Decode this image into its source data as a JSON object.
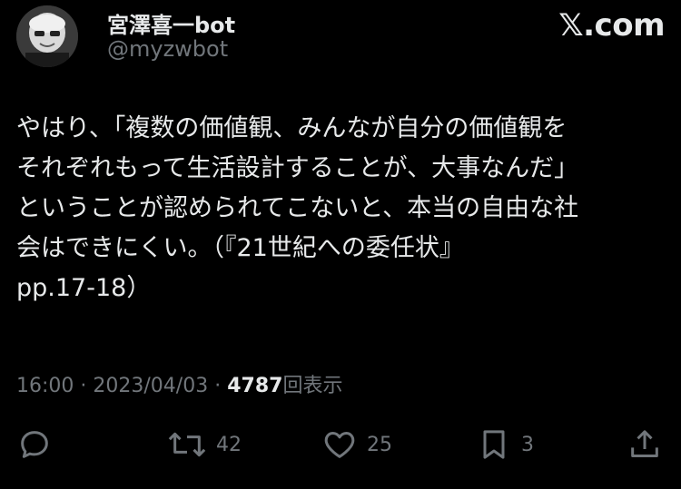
{
  "author": {
    "display_name": "宮澤喜一bot",
    "handle": "@myzwbot",
    "avatar_icon": "avatar-photo-icon"
  },
  "brand": {
    "text": "𝕏.com",
    "icon": "x-logo-icon"
  },
  "tweet": {
    "lines": [
      "やはり、「複数の価値観、みんなが自分の価値観を",
      "それぞれもって生活設計することが、大事なんだ」",
      "ということが認められてこないと、本当の自由な社",
      "会はできにくい。（『21世紀への委任状』",
      "pp.17-18）"
    ]
  },
  "meta": {
    "time": "16:00",
    "separator": "·",
    "date": "2023/04/03",
    "views_count": "4787",
    "views_label": "回表示"
  },
  "actions": {
    "reply": {
      "icon": "reply-icon",
      "count": ""
    },
    "repost": {
      "icon": "repost-icon",
      "count": "42"
    },
    "like": {
      "icon": "heart-icon",
      "count": "25"
    },
    "bookmark": {
      "icon": "bookmark-icon",
      "count": "3"
    },
    "share": {
      "icon": "share-icon",
      "count": ""
    }
  },
  "colors": {
    "background": "#000000",
    "primary_text": "#e7e9ea",
    "secondary_text": "#71767b"
  }
}
